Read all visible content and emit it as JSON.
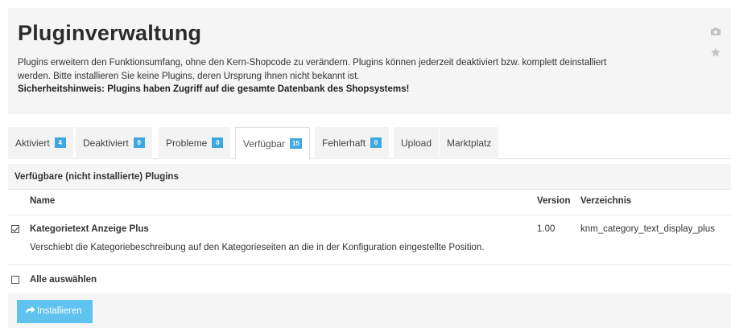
{
  "header": {
    "title": "Pluginverwaltung",
    "description_line1": "Plugins erweitern den Funktionsumfang, ohne den Kern-Shopcode zu verändern. Plugins können jederzeit deaktiviert bzw. komplett deinstalliert",
    "description_line2": "werden. Bitte installieren Sie keine Plugins, deren Ursprung Ihnen nicht bekannt ist.",
    "security_note": "Sicherheitshinweis: Plugins haben Zugriff auf die gesamte Datenbank des Shopsystems!",
    "icons": [
      "camera-icon",
      "star-icon"
    ]
  },
  "tabs": [
    {
      "label": "Aktiviert",
      "count": "4"
    },
    {
      "label": "Deaktiviert",
      "count": "0"
    },
    {
      "label": "Probleme",
      "count": "0"
    },
    {
      "label": "Verfügbar",
      "count": "15",
      "active": true
    },
    {
      "label": "Fehlerhaft",
      "count": "0"
    },
    {
      "label": "Upload"
    },
    {
      "label": "Marktplatz"
    }
  ],
  "panel": {
    "heading": "Verfügbare (nicht installierte) Plugins",
    "columns": {
      "name": "Name",
      "version": "Version",
      "directory": "Verzeichnis"
    },
    "rows": [
      {
        "checked": true,
        "name": "Kategorietext Anzeige Plus",
        "description": "Verschiebt die Kategoriebeschreibung auf den Kategorieseiten an die in der Konfiguration eingestellte Position.",
        "version": "1.00",
        "directory": "knm_category_text_display_plus"
      }
    ],
    "select_all_label": "Alle auswählen",
    "install_button": "Installieren"
  },
  "colors": {
    "badge": "#3fa7e0",
    "button": "#5fc2ef",
    "header_bg": "#f5f5f5"
  }
}
